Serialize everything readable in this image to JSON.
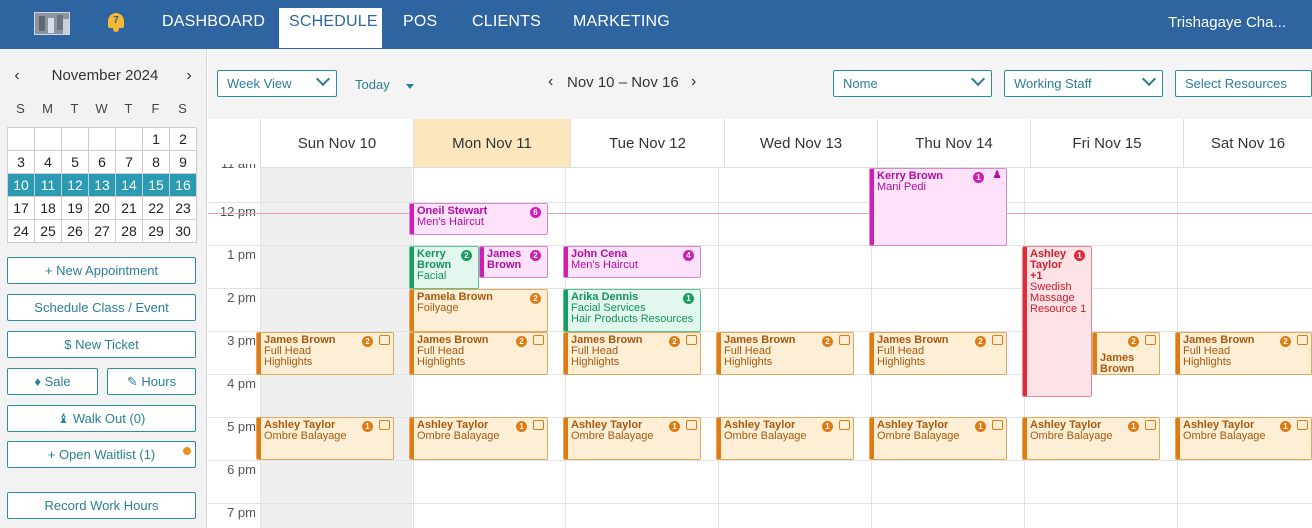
{
  "nav": {
    "notification_count": "7",
    "items": [
      "DASHBOARD",
      "SCHEDULE",
      "POS",
      "CLIENTS",
      "MARKETING"
    ],
    "active": "SCHEDULE",
    "user": "Trishagaye Cha..."
  },
  "mini_calendar": {
    "title": "November 2024",
    "prev": "‹",
    "next": "›",
    "dow": [
      "S",
      "M",
      "T",
      "W",
      "T",
      "F",
      "S"
    ],
    "weeks": [
      [
        "",
        "",
        "",
        "",
        "",
        "1",
        "2"
      ],
      [
        "3",
        "4",
        "5",
        "6",
        "7",
        "8",
        "9"
      ],
      [
        "10",
        "11",
        "12",
        "13",
        "14",
        "15",
        "16"
      ],
      [
        "17",
        "18",
        "19",
        "20",
        "21",
        "22",
        "23"
      ],
      [
        "24",
        "25",
        "26",
        "27",
        "28",
        "29",
        "30"
      ]
    ],
    "selected_week": 2
  },
  "left_buttons": {
    "new_appointment": "+ New Appointment",
    "schedule_class": "Schedule Class / Event",
    "new_ticket": "$  New Ticket",
    "sale": "Sale",
    "hours": "Hours",
    "walk_out": "Walk Out (0)",
    "open_waitlist": "+ Open Waitlist (1)",
    "record_work_hours": "Record Work Hours"
  },
  "toolbar": {
    "view": "Week View",
    "today": "Today",
    "date_range": "Nov 10 – Nov 16",
    "filter1": "Nome",
    "filter2": "Working Staff",
    "filter3": "Select Resources"
  },
  "days": [
    "Sun Nov 10",
    "Mon Nov 11",
    "Tue Nov 12",
    "Wed Nov 13",
    "Thu Nov 14",
    "Fri Nov 15",
    "Sat Nov 16"
  ],
  "times": [
    "11 am",
    "12 pm",
    "1 pm",
    "2 pm",
    "3 pm",
    "4 pm",
    "5 pm",
    "6 pm",
    "7 pm"
  ],
  "appointments": [
    {
      "name": "Kerry Brown",
      "service": "Mani Pedi",
      "badge": "1",
      "color": "pink"
    },
    {
      "name": "Oneil Stewart",
      "service": "Men's Haircut",
      "badge": "6",
      "color": "pink"
    },
    {
      "name": "Kerry Brown",
      "service": "Facial",
      "badge": "2",
      "color": "green"
    },
    {
      "name": "James Brown",
      "service": "",
      "badge": "2",
      "color": "pink"
    },
    {
      "name": "John Cena",
      "service": "Men's Haircut",
      "badge": "4",
      "color": "pink"
    },
    {
      "name": "Pamela Brown",
      "service": "Foilyage",
      "badge": "2",
      "color": "orange"
    },
    {
      "name": "Arika Dennis",
      "service": "Facial Services",
      "extra": "Hair Products Resources",
      "badge": "1",
      "color": "green"
    },
    {
      "name": "Ashley Taylor",
      "service": "+1",
      "extra": "Swedish Massage Resource 1",
      "badge": "1",
      "color": "red"
    },
    {
      "name": "James Brown",
      "service": "Full Head Highlights",
      "badge": "2",
      "color": "orange"
    },
    {
      "name": "Ashley Taylor",
      "service": "Ombre Balayage",
      "badge": "1",
      "color": "orange"
    }
  ]
}
